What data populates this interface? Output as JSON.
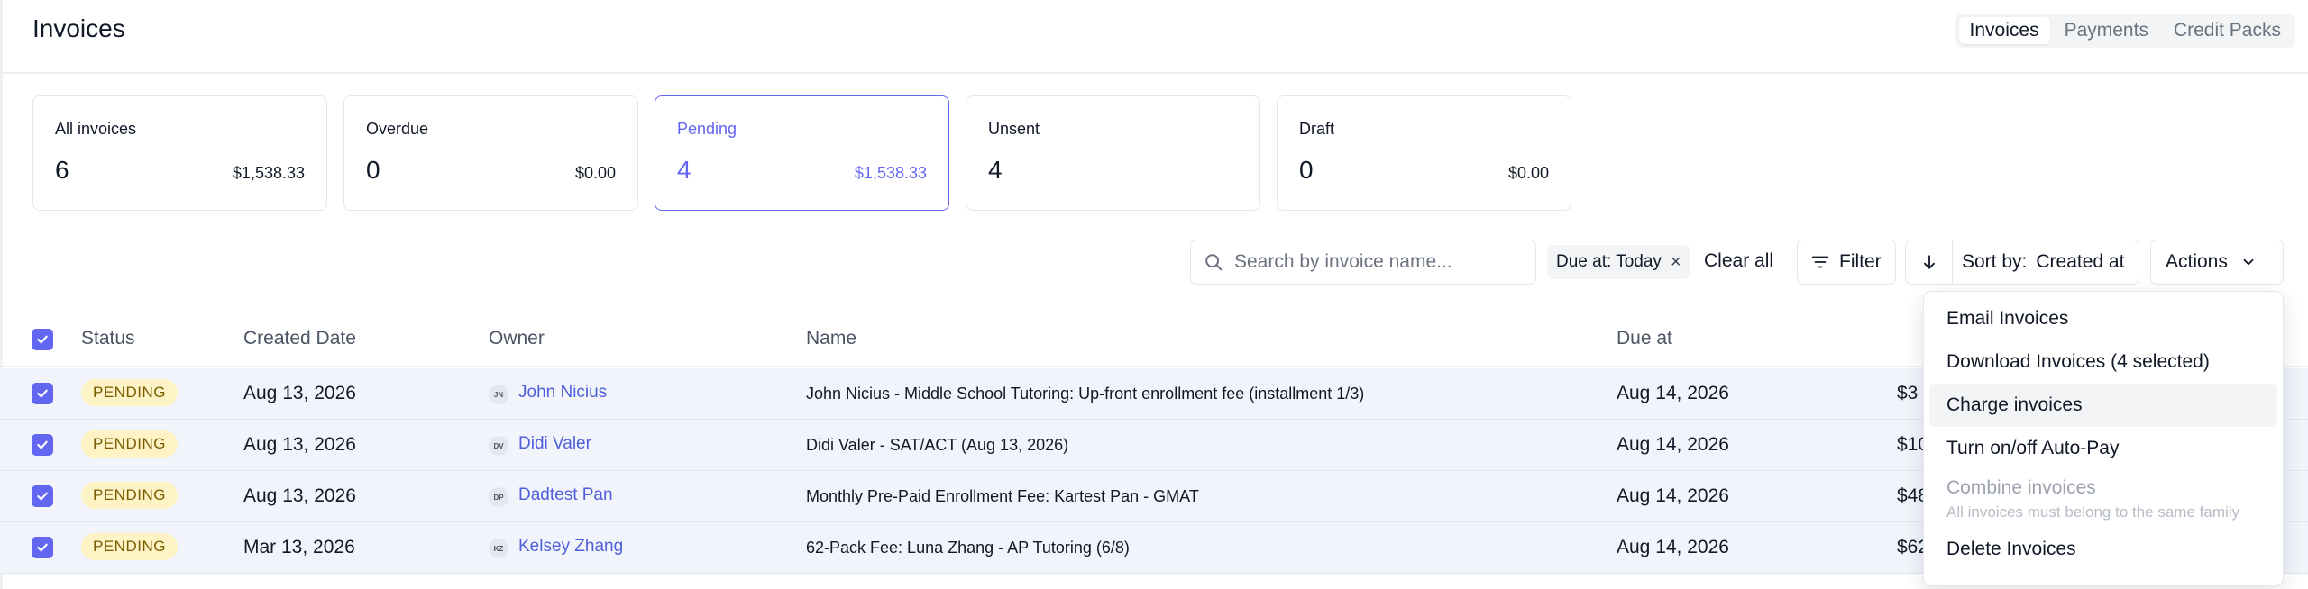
{
  "header": {
    "title": "Invoices",
    "tabs": [
      {
        "label": "Invoices",
        "active": true
      },
      {
        "label": "Payments",
        "active": false
      },
      {
        "label": "Credit Packs",
        "active": false
      }
    ]
  },
  "stats": [
    {
      "label": "All invoices",
      "count": "6",
      "amount": "$1,538.33",
      "active": false
    },
    {
      "label": "Overdue",
      "count": "0",
      "amount": "$0.00",
      "active": false
    },
    {
      "label": "Pending",
      "count": "4",
      "amount": "$1,538.33",
      "active": true
    },
    {
      "label": "Unsent",
      "count": "4",
      "amount": "",
      "active": false
    },
    {
      "label": "Draft",
      "count": "0",
      "amount": "$0.00",
      "active": false
    }
  ],
  "toolbar": {
    "search_placeholder": "Search by invoice name...",
    "chip_label": "Due at: Today",
    "clear_all": "Clear all",
    "filter_label": "Filter",
    "sort_key": "Sort by:",
    "sort_value": "Created at",
    "actions_label": "Actions"
  },
  "table": {
    "columns": [
      "Status",
      "Created Date",
      "Owner",
      "Name",
      "Due at"
    ],
    "rows": [
      {
        "status": "PENDING",
        "created": "Aug 13, 2026",
        "initials": "JN",
        "owner": "John Nicius",
        "name": "John Nicius - Middle School Tutoring: Up-front enrollment fee (installment 1/3)",
        "due": "Aug 14, 2026",
        "amount_partial": "$3"
      },
      {
        "status": "PENDING",
        "created": "Aug 13, 2026",
        "initials": "DV",
        "owner": "Didi Valer",
        "name": "Didi Valer - SAT/ACT (Aug 13, 2026)",
        "due": "Aug 14, 2026",
        "amount_partial": "$10"
      },
      {
        "status": "PENDING",
        "created": "Aug 13, 2026",
        "initials": "DP",
        "owner": "Dadtest Pan",
        "name": "Monthly Pre-Paid Enrollment Fee: Kartest Pan - GMAT",
        "due": "Aug 14, 2026",
        "amount_partial": "$48"
      },
      {
        "status": "PENDING",
        "created": "Mar 13, 2026",
        "initials": "KZ",
        "owner": "Kelsey Zhang",
        "name": "62-Pack Fee: Luna Zhang - AP Tutoring (6/8)",
        "due": "Aug 14, 2026",
        "amount_partial": "$62"
      }
    ]
  },
  "actions_menu": {
    "items": [
      {
        "label": "Email Invoices"
      },
      {
        "label": "Download Invoices (4 selected)"
      },
      {
        "label": "Charge invoices"
      },
      {
        "label": "Turn on/off Auto-Pay"
      },
      {
        "label": "Combine invoices",
        "sub": "All invoices must belong to the same family"
      },
      {
        "label": "Delete Invoices"
      }
    ]
  },
  "colors": {
    "accent": "#6366f1",
    "badge_bg": "#fdf3c4",
    "row_bg": "#f1f4fa"
  }
}
